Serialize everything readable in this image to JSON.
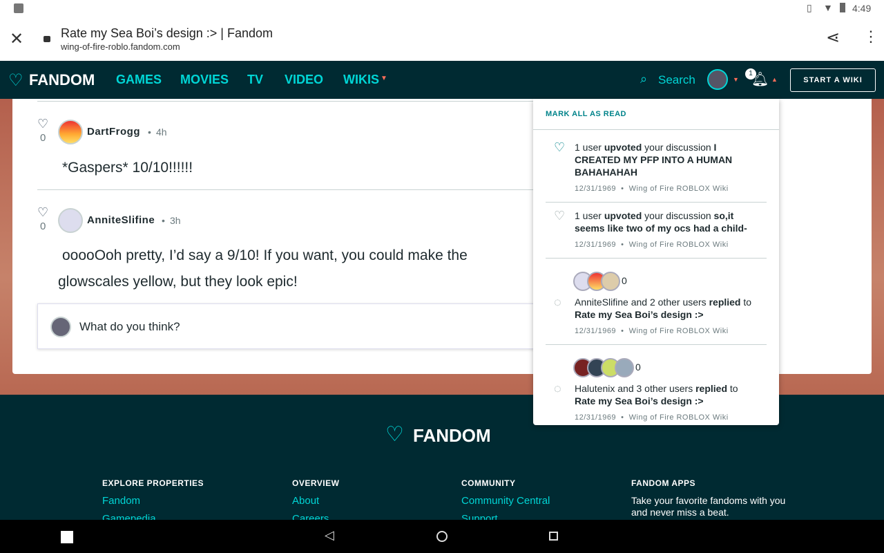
{
  "status": {
    "time": "4:49"
  },
  "browser": {
    "title": "Rate my Sea Boi’s design :> | Fandom",
    "url": "wing-of-fire-roblo.fandom.com"
  },
  "nav": {
    "logo": "FANDOM",
    "links": [
      "GAMES",
      "MOVIES",
      "TV",
      "VIDEO",
      "WIKIS"
    ],
    "search": "Search",
    "notif_count": "1",
    "start_wiki": "START A WIKI"
  },
  "comments": [
    {
      "user": "DartFrogg",
      "time": "4h",
      "likes": "0",
      "text": "*Gaspers* 10/10!!!!!!"
    },
    {
      "user": "AnniteSlifine",
      "time": "3h",
      "likes": "0",
      "text_line1": "ooooOoh pretty, I’d say a 9/10! If you want, you could make the",
      "text_line2": "glowscales yellow, but they look epic!"
    }
  ],
  "reply": {
    "placeholder": "What do you think?"
  },
  "notifications": {
    "mark_all": "MARK ALL AS READ",
    "items": [
      {
        "pre": "1 user ",
        "verb": "upvoted",
        "mid": " your discussion ",
        "title": "I CREATED MY PFP INTO A HUMAN BAHAHAHAH",
        "date": "12/31/1969",
        "wiki": "Wing of Fire ROBLOX Wiki"
      },
      {
        "pre": "1 user ",
        "verb": "upvoted",
        "mid": " your discussion ",
        "title": "so,it seems like two of my ocs had a child-",
        "date": "12/31/1969",
        "wiki": "Wing of Fire ROBLOX Wiki"
      },
      {
        "count": "0",
        "pre": "AnniteSlifine and 2 other users ",
        "verb": "replied",
        "mid": " to ",
        "title": "Rate my Sea Boi’s design :>",
        "date": "12/31/1969",
        "wiki": "Wing of Fire ROBLOX Wiki"
      },
      {
        "count": "0",
        "pre": "Halutenix and 3 other users ",
        "verb": "replied",
        "mid": " to ",
        "title": "Rate my Sea Boi’s design :>",
        "date": "12/31/1969",
        "wiki": "Wing of Fire ROBLOX Wiki"
      }
    ]
  },
  "footer": {
    "logo": "FANDOM",
    "columns": [
      {
        "heading": "EXPLORE PROPERTIES",
        "links": [
          "Fandom",
          "Gamepedia"
        ]
      },
      {
        "heading": "OVERVIEW",
        "links": [
          "About",
          "Careers"
        ]
      },
      {
        "heading": "COMMUNITY",
        "links": [
          "Community Central",
          "Support"
        ]
      },
      {
        "heading": "FANDOM APPS",
        "text": "Take your favorite fandoms with you and never miss a beat."
      }
    ]
  },
  "colors": {
    "accent": "#00d6d6",
    "nav_bg": "#002a32",
    "badge": "#ff6e5a"
  }
}
